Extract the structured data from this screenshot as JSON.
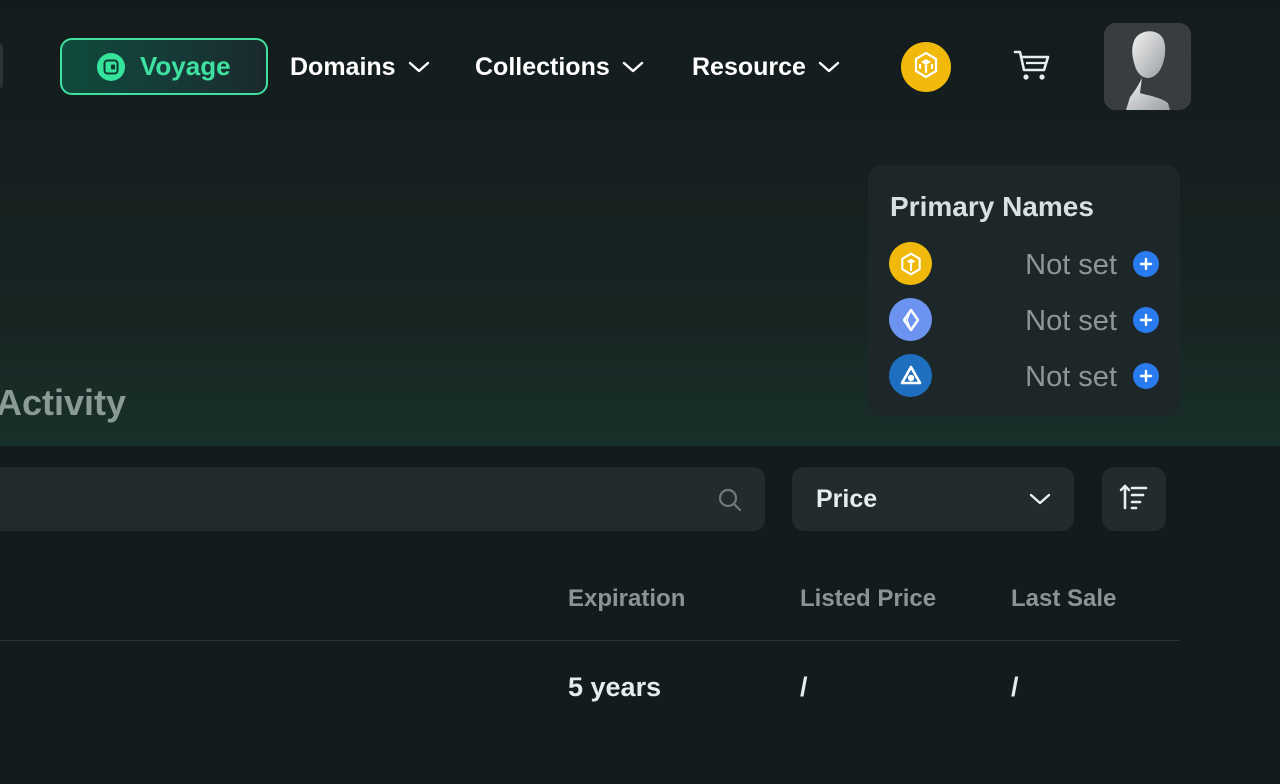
{
  "header": {
    "brand_label": "Voyage",
    "nav": [
      {
        "label": "Domains"
      },
      {
        "label": "Collections"
      },
      {
        "label": "Resource"
      }
    ]
  },
  "primary_names": {
    "title": "Primary Names",
    "rows": [
      {
        "chain_icon": "bnb-icon",
        "status": "Not set"
      },
      {
        "chain_icon": "ens-icon",
        "status": "Not set"
      },
      {
        "chain_icon": "arbitrum-icon",
        "status": "Not set"
      }
    ]
  },
  "tabs": {
    "activity_label": "Activity"
  },
  "filters": {
    "search_placeholder": "",
    "sort_select_value": "Price"
  },
  "table": {
    "columns": [
      "Expiration",
      "Listed Price",
      "Last Sale"
    ],
    "rows": [
      {
        "expiration": "5 years",
        "listed_price": "/",
        "last_sale": "/"
      }
    ]
  },
  "colors": {
    "accent": "#3fe0a0",
    "bnb": "#f0b90b",
    "add": "#2a7bf0",
    "background": "#141b1d"
  }
}
